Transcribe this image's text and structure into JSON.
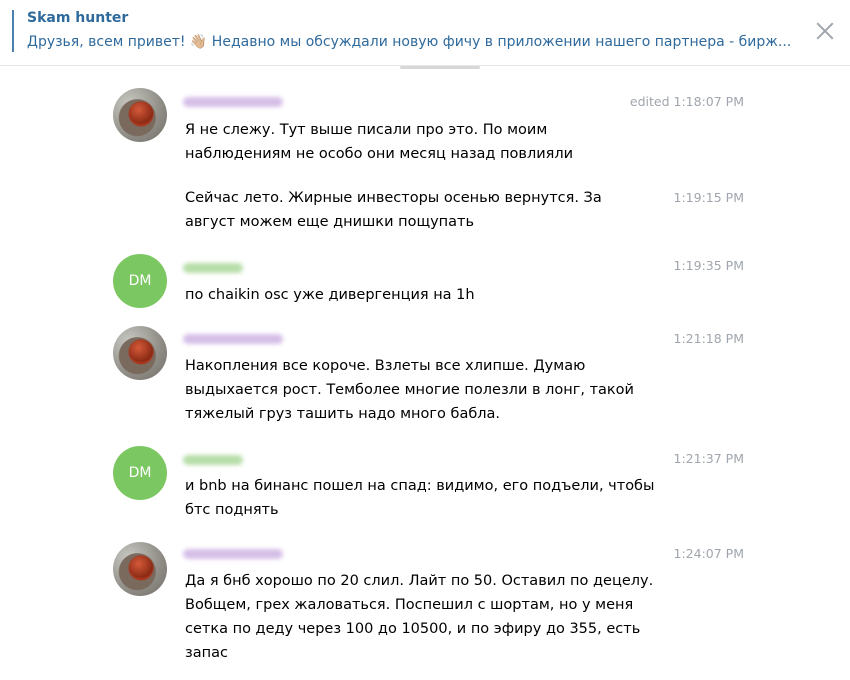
{
  "pinned": {
    "title": "Skam hunter",
    "text_before_emoji": "Друзья, всем привет! ",
    "emoji": "👋🏼",
    "text_after_emoji": " Недавно мы обсуждали новую фичу в приложении нашего партнера - бирж..."
  },
  "messages": [
    {
      "avatar": "photo",
      "time": "edited 1:18:07 PM",
      "text": "Я не слежу. Тут выше писали про это. По моим наблюдениям не особо они месяц назад повлияли"
    },
    {
      "avatar": "",
      "time": "1:19:15 PM",
      "text": "Сейчас лето. Жирные инвесторы осенью вернутся. За август можем еще днишки пощупать"
    },
    {
      "avatar": "DM",
      "time": "1:19:35 PM",
      "text": "по chaikin osc уже дивергенция на 1h"
    },
    {
      "avatar": "photo",
      "time": "1:21:18 PM",
      "text": "Накопления все короче. Взлеты все хлипше. Думаю выдыхается рост. Темболее многие полезли в лонг, такой тяжелый груз ташить надо много бабла."
    },
    {
      "avatar": "DM",
      "time": "1:21:37 PM",
      "text": "и bnb на бинанс пошел на спад: видимо, его подъели, чтобы бтс поднять"
    },
    {
      "avatar": "photo",
      "time": "1:24:07 PM",
      "text": "Да я бнб хорошо по 20 слил. Лайт по 50. Оставил по децелу. Вобщем, грех жаловаться. Поспешил с шортам, но у меня сетка по деду через 100 до 10500, и по эфиру до 355, есть запас"
    }
  ],
  "colors": {
    "link_blue": "#2f6a9d",
    "time_gray": "#a0a6ad",
    "avatar_green": "#7bc862"
  },
  "icons": {
    "close": "close-icon"
  }
}
